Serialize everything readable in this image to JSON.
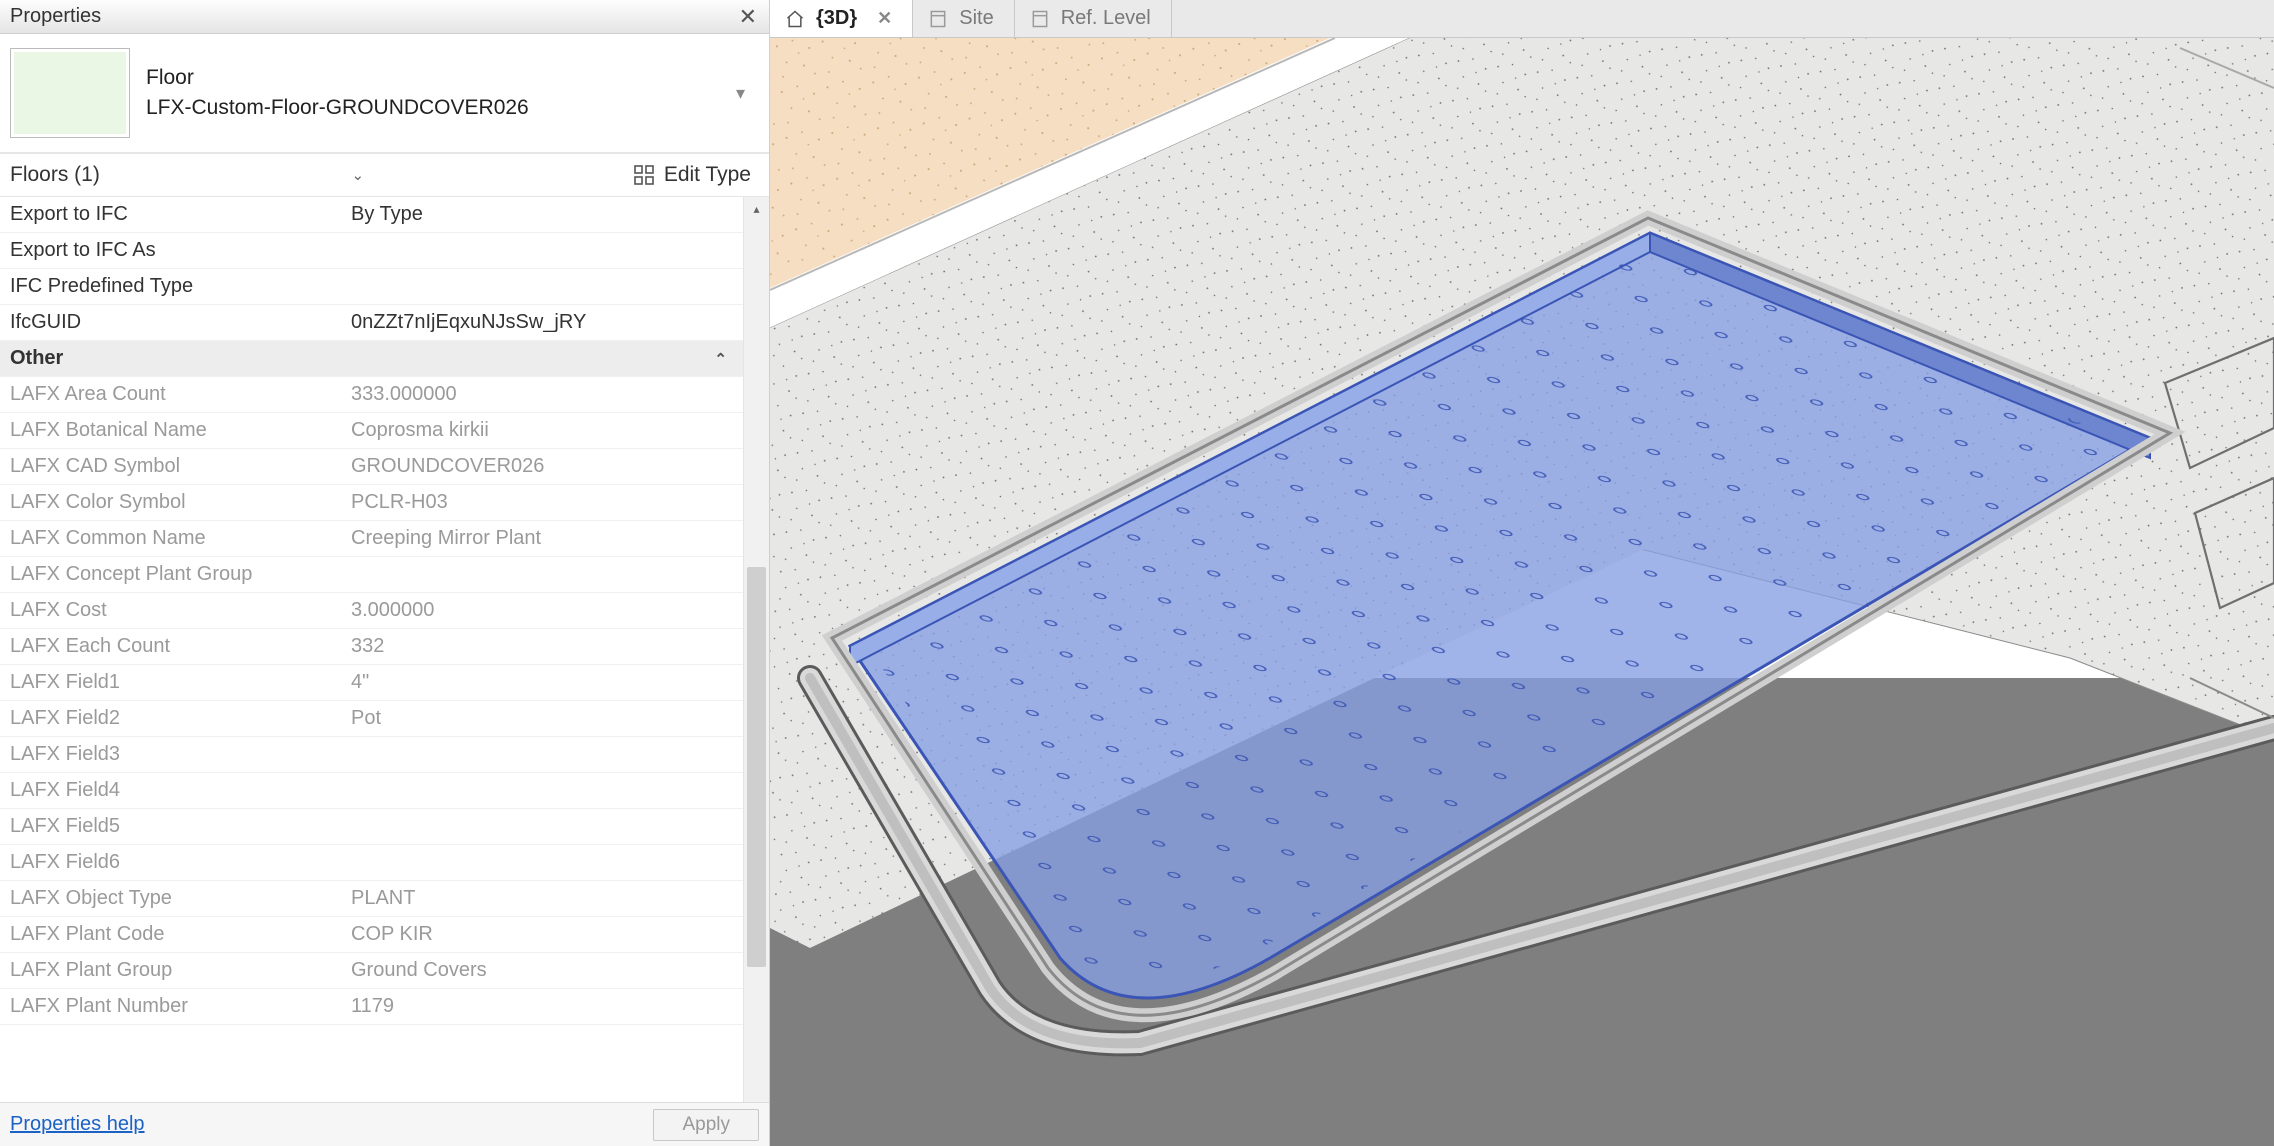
{
  "panel": {
    "title": "Properties",
    "family_category": "Floor",
    "family_type": "LFX-Custom-Floor-GROUNDCOVER026",
    "selection_label": "Floors (1)",
    "edit_type_label": "Edit Type",
    "help_label": "Properties help",
    "apply_label": "Apply"
  },
  "props_editable": [
    {
      "label": "Export to IFC",
      "value": "By Type"
    },
    {
      "label": "Export to IFC As",
      "value": ""
    },
    {
      "label": "IFC Predefined Type",
      "value": ""
    },
    {
      "label": "IfcGUID",
      "value": "0nZZt7nIjEqxuNJsSw_jRY"
    }
  ],
  "section_other": "Other",
  "props_readonly": [
    {
      "label": "LAFX Area Count",
      "value": "333.000000"
    },
    {
      "label": "LAFX Botanical Name",
      "value": "Coprosma kirkii"
    },
    {
      "label": "LAFX CAD Symbol",
      "value": "GROUNDCOVER026"
    },
    {
      "label": "LAFX Color Symbol",
      "value": "PCLR-H03"
    },
    {
      "label": "LAFX Common Name",
      "value": "Creeping Mirror Plant"
    },
    {
      "label": "LAFX Concept Plant Group",
      "value": ""
    },
    {
      "label": "LAFX Cost",
      "value": "3.000000"
    },
    {
      "label": "LAFX Each Count",
      "value": "332"
    },
    {
      "label": "LAFX Field1",
      "value": "4\""
    },
    {
      "label": "LAFX Field2",
      "value": "Pot"
    },
    {
      "label": "LAFX Field3",
      "value": ""
    },
    {
      "label": "LAFX Field4",
      "value": ""
    },
    {
      "label": "LAFX Field5",
      "value": ""
    },
    {
      "label": "LAFX Field6",
      "value": ""
    },
    {
      "label": "LAFX Object Type",
      "value": "PLANT"
    },
    {
      "label": "LAFX Plant Code",
      "value": "COP KIR"
    },
    {
      "label": "LAFX Plant Group",
      "value": "Ground Covers"
    },
    {
      "label": "LAFX Plant Number",
      "value": "1179"
    }
  ],
  "tabs": [
    {
      "label": "{3D}",
      "active": true,
      "closeable": true,
      "icon": "home"
    },
    {
      "label": "Site",
      "active": false,
      "closeable": false,
      "icon": "sheet"
    },
    {
      "label": "Ref. Level",
      "active": false,
      "closeable": false,
      "icon": "sheet"
    }
  ],
  "colors": {
    "selection_fill": "#879fe3",
    "selection_stroke": "#3a55b5",
    "concrete_light": "#e7e7e6",
    "concrete_stroke": "#8b8b8b",
    "sand": "#f5dec1",
    "ground": "#7f7f7f"
  }
}
